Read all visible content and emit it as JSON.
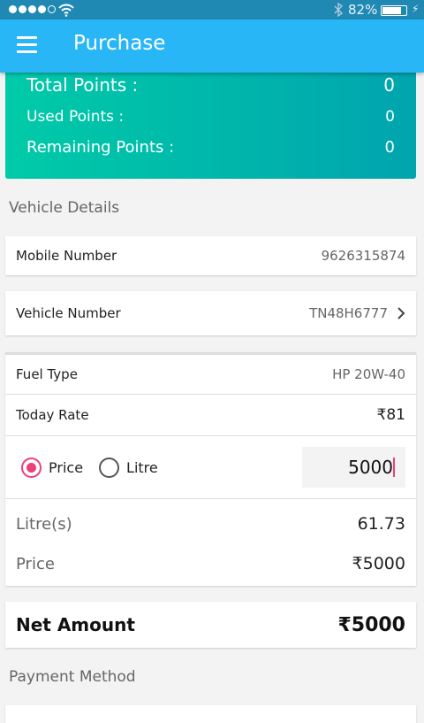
{
  "status_bar": {
    "signal_bars_filled": 4,
    "signal_bars_total": 5,
    "battery": "82%",
    "battery_level": 0.82
  },
  "app_bar": {
    "title": "Purchase"
  },
  "points": {
    "total_label": "Total Points  :",
    "total_value": "0",
    "used_label": "Used Points  :",
    "used_value": "0",
    "remaining_label": "Remaining Points  :",
    "remaining_value": "0"
  },
  "vehicle_details": {
    "section_label": "Vehicle Details",
    "mobile_label": "Mobile Number",
    "mobile_value": "9626315874",
    "vehicle_label": "Vehicle Number",
    "vehicle_value": "TN48H6777"
  },
  "fuel": {
    "fuel_type_label": "Fuel Type",
    "fuel_type_value": "HP 20W-40",
    "rate_label": "Today Rate",
    "rate_value": "₹81",
    "radio_price": "Price",
    "radio_litre": "Litre",
    "selected": "Price",
    "input_value": "5000",
    "litres_label": "Litre(s)",
    "litres_value": "61.73",
    "price_label": "Price",
    "price_value": "₹5000"
  },
  "net": {
    "label": "Net Amount",
    "value": "₹5000"
  },
  "payment": {
    "section_label": "Payment Method"
  },
  "colors": {
    "status_bar": "#2089b3",
    "app_bar": "#29b6f6",
    "points_start": "#00cba8",
    "points_end": "#00a4ae",
    "accent": "#ec407a"
  }
}
